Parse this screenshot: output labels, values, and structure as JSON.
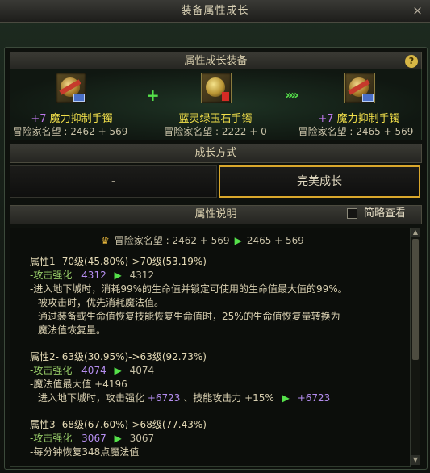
{
  "window": {
    "title": "装备属性成长",
    "close_label": "×"
  },
  "equip_section": {
    "title": "属性成长装备",
    "help_label": "?",
    "source": {
      "plus": "+7",
      "name": "魔力抑制手镯",
      "fame": "冒险家名望 : 2462 + 569"
    },
    "material": {
      "name": "蓝灵绿玉石手镯",
      "fame": "冒险家名望 : 2222 + 0"
    },
    "result": {
      "plus": "+7",
      "name": "魔力抑制手镯",
      "fame": "冒险家名望 : 2465 + 569"
    },
    "plus_symbol": "+",
    "arrow_symbol": "»»"
  },
  "growth_section": {
    "title": "成长方式",
    "options": [
      "-",
      "完美成长"
    ],
    "selected": "完美成长"
  },
  "desc_section": {
    "title": "属性说明",
    "checkbox_label": "简略查看",
    "fame": {
      "label": "冒险家名望 : 2462 + 569",
      "arrow": "▶",
      "after": "2465 + 569"
    },
    "attr1": {
      "title": "属性1- 70级(45.80%)->70级(53.19%)",
      "stat_label": "-攻击强化",
      "stat_from": "4312",
      "arrow": "▶",
      "stat_to": "4312",
      "lines": [
        "-进入地下城时，消耗99%的生命值并锁定可使用的生命值最大值的99%。",
        "被攻击时，优先消耗魔法值。",
        "通过装备或生命值恢复技能恢复生命值时，25%的生命值恢复量转换为",
        "魔法值恢复量。"
      ]
    },
    "attr2": {
      "title": "属性2- 63级(30.95%)->63级(92.73%)",
      "stat_label": "-攻击强化",
      "stat_from": "4074",
      "arrow": "▶",
      "stat_to": "4074",
      "line1": "-魔法值最大值 +4196",
      "line2_a": "进入地下城时，攻击强化",
      "line2_b": "+6723",
      "line2_c": "、技能攻击力 +15%",
      "line2_arrow": "▶",
      "line2_d": "+6723"
    },
    "attr3": {
      "title": "属性3- 68级(67.60%)->68级(77.43%)",
      "stat_label": "-攻击强化",
      "stat_from": "3067",
      "arrow": "▶",
      "stat_to": "3067",
      "line1": "-每分钟恢复348点魔法值"
    }
  }
}
